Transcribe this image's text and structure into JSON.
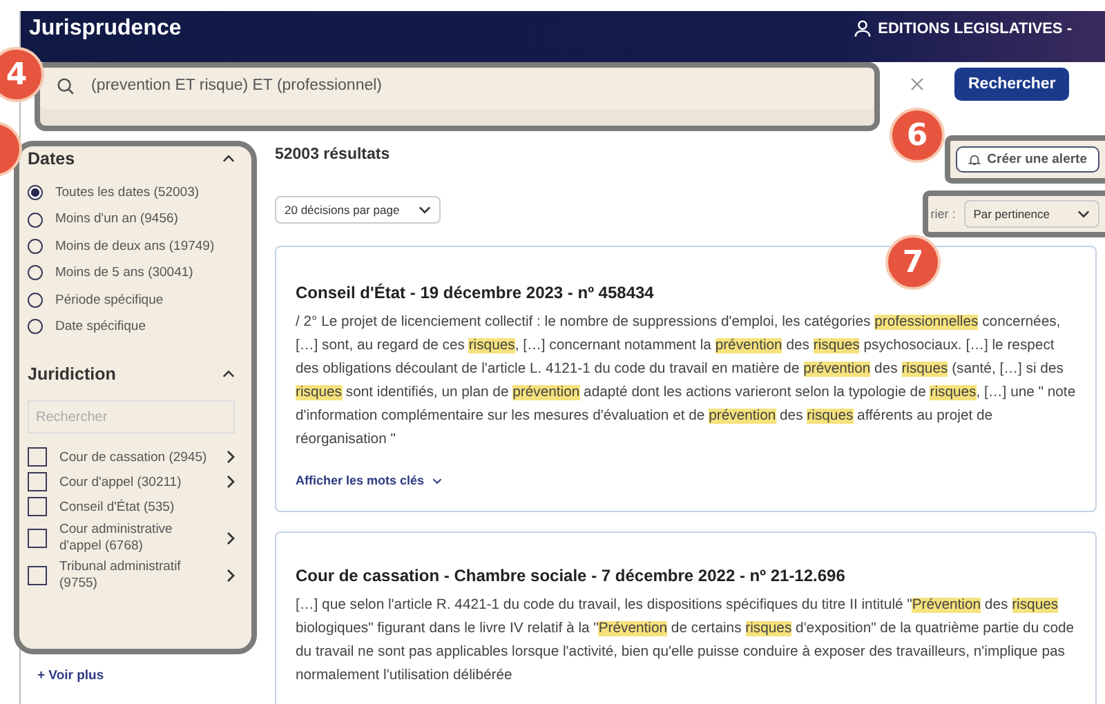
{
  "header": {
    "logo": "Jurisprudence",
    "account": "EDITIONS LEGISLATIVES -"
  },
  "search": {
    "value": "(prevention ET risque) ET (professionnel)",
    "button": "Rechercher"
  },
  "markers": [
    {
      "number": "4"
    },
    {
      "number": "6"
    },
    {
      "number": "7"
    }
  ],
  "filters": {
    "dates": {
      "title": "Dates",
      "expanded": true,
      "options": [
        {
          "label": "Toutes les dates (52003)",
          "selected": true
        },
        {
          "label": "Moins d'un an (9456)",
          "selected": false
        },
        {
          "label": "Moins de deux ans (19749)",
          "selected": false
        },
        {
          "label": "Moins de 5 ans (30041)",
          "selected": false
        },
        {
          "label": "Période spécifique",
          "selected": false
        },
        {
          "label": "Date spécifique",
          "selected": false
        }
      ]
    },
    "juridiction": {
      "title": "Juridiction",
      "expanded": true,
      "placeholder": "Rechercher",
      "items": [
        {
          "label": "Cour de cassation (2945)",
          "checked": false,
          "has_children": true
        },
        {
          "label": "Cour d'appel (30211)",
          "checked": false,
          "has_children": true
        },
        {
          "label": "Conseil d'État (535)",
          "checked": false,
          "has_children": false
        },
        {
          "label": "Cour administrative d'appel (6768)",
          "checked": false,
          "has_children": true
        },
        {
          "label": "Tribunal administratif (9755)",
          "checked": false,
          "has_children": true
        }
      ]
    },
    "more": "+ Voir plus"
  },
  "results": {
    "count": "52003 résultats",
    "per_page": "20 décisions par page",
    "alert_button": "Créer une alerte",
    "sort_label": "rier :",
    "sort_value": "Par pertinence",
    "items": [
      {
        "title": "Conseil d'État - 19 décembre 2023 - nº 458434",
        "excerpt": [
          {
            "text": "/ 2° Le projet de licenciement collectif : le nombre de suppressions d'emploi, les catégories ",
            "highlight": false
          },
          {
            "text": "professionnelles",
            "highlight": true
          },
          {
            "text": " concernées, […] sont, au regard de ces ",
            "highlight": false
          },
          {
            "text": "risques",
            "highlight": true
          },
          {
            "text": ", […] concernant notamment la ",
            "highlight": false
          },
          {
            "text": "prévention",
            "highlight": true
          },
          {
            "text": " des ",
            "highlight": false
          },
          {
            "text": "risques",
            "highlight": true
          },
          {
            "text": " psychosociaux. […] le respect des obligations découlant de l'article L. 4121-1 du code du travail en matière de ",
            "highlight": false
          },
          {
            "text": "prévention",
            "highlight": true
          },
          {
            "text": " des ",
            "highlight": false
          },
          {
            "text": "risques",
            "highlight": true
          },
          {
            "text": " (santé, […] si des ",
            "highlight": false
          },
          {
            "text": "risques",
            "highlight": true
          },
          {
            "text": " sont identifiés, un plan de ",
            "highlight": false
          },
          {
            "text": "prévention",
            "highlight": true
          },
          {
            "text": " adapté dont les actions varieront selon la typologie de ",
            "highlight": false
          },
          {
            "text": "risques",
            "highlight": true
          },
          {
            "text": ", […] une \" note d'information complémentaire sur les mesures d'évaluation et de ",
            "highlight": false
          },
          {
            "text": "prévention",
            "highlight": true
          },
          {
            "text": " des ",
            "highlight": false
          },
          {
            "text": "risques",
            "highlight": true
          },
          {
            "text": " afférents au projet de réorganisation \"",
            "highlight": false
          }
        ],
        "keywords_link": "Afficher les mots clés"
      },
      {
        "title": "Cour de cassation - Chambre sociale - 7 décembre 2022 - nº 21-12.696",
        "excerpt": [
          {
            "text": "[…] que selon l'article R. 4421-1 du code du travail, les dispositions spécifiques du titre II intitulé \"",
            "highlight": false
          },
          {
            "text": "Prévention",
            "highlight": true
          },
          {
            "text": " des ",
            "highlight": false
          },
          {
            "text": "risques",
            "highlight": true
          },
          {
            "text": " biologiques\" figurant dans le livre IV relatif à la \"",
            "highlight": false
          },
          {
            "text": "Prévention",
            "highlight": true
          },
          {
            "text": " de certains ",
            "highlight": false
          },
          {
            "text": "risques",
            "highlight": true
          },
          {
            "text": " d'exposition\" de la quatrième partie du code du travail ne sont pas applicables lorsque l'activité, bien qu'elle puisse conduire à exposer des travailleurs, n'implique pas normalement l'utilisation délibérée",
            "highlight": false
          }
        ]
      }
    ]
  }
}
